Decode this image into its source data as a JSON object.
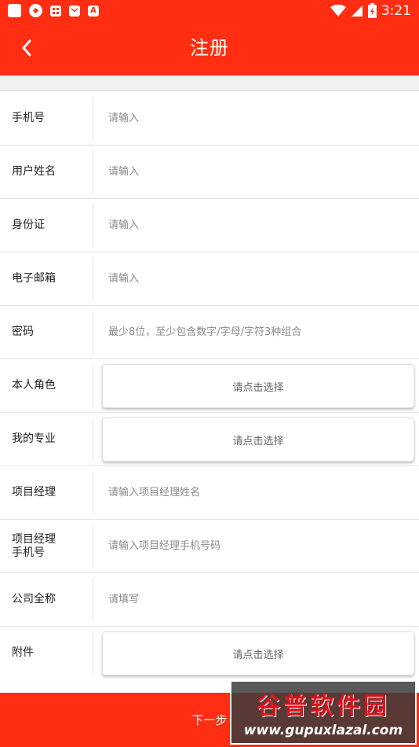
{
  "status_bar": {
    "time": "3:21",
    "icons": [
      "app-square-icon",
      "app-arrows-icon",
      "app-grid-icon",
      "app-mail-icon",
      "app-a-icon"
    ],
    "battery_glyph": "⚡"
  },
  "header": {
    "title": "注册",
    "back_icon": "chevron-left-icon"
  },
  "form": {
    "phone": {
      "label": "手机号",
      "placeholder": "请输入"
    },
    "username": {
      "label": "用户姓名",
      "placeholder": "请输入"
    },
    "id_card": {
      "label": "身份证",
      "placeholder": "请输入"
    },
    "email": {
      "label": "电子邮箱",
      "placeholder": "请输入"
    },
    "password": {
      "label": "密码",
      "placeholder": "最少8位，至少包含数字/字母/字符3种组合"
    },
    "role": {
      "label": "本人角色",
      "button": "请点击选择"
    },
    "major": {
      "label": "我的专业",
      "button": "请点击选择"
    },
    "pm_name": {
      "label": "项目经理",
      "placeholder": "请输入项目经理姓名"
    },
    "pm_phone": {
      "label_line1": "项目经理",
      "label_line2": "手机号",
      "placeholder": "请输入项目经理手机号码"
    },
    "company": {
      "label": "公司全称",
      "placeholder": "请填写"
    },
    "attachment": {
      "label": "附件",
      "button": "请点击选择"
    }
  },
  "footer": {
    "next_label": "下一步"
  },
  "watermark": {
    "line1": "谷普软件园",
    "line2": "www.gupuxlazal.com"
  },
  "colors": {
    "brand": "#ff2d11",
    "background_strip": "#f0f0f3",
    "placeholder": "#8a8a8a"
  }
}
